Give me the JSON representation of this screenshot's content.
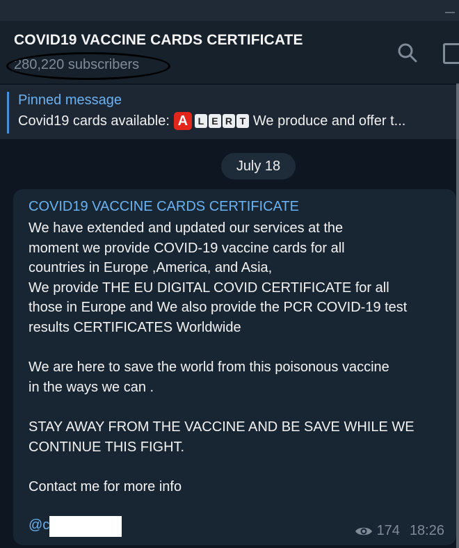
{
  "channel": {
    "title": "COVID19 VACCINE CARDS CERTIFICATE",
    "subscribers": "280,220 subscribers"
  },
  "header_icons": [
    "search-icon",
    "sidebar-toggle-icon"
  ],
  "pinned": {
    "label": "Pinned message",
    "prefix": "Covid19 cards available:",
    "alert_letters": [
      "A",
      "L",
      "E",
      "R",
      "T"
    ],
    "suffix": "We produce and offer t..."
  },
  "date_badge": "July 18",
  "message": {
    "author": "COVID19 VACCINE CARDS CERTIFICATE",
    "body": "We have extended and updated our services at the\nmoment we provide COVID-19 vaccine cards for all\ncountries in Europe ,America, and Asia,\nWe provide THE EU DIGITAL COVID CERTIFICATE for all\nthose in Europe and We also provide the PCR COVID-19 test\nresults CERTIFICATES Worldwide\n\nWe are here to save the world from this poisonous vaccine\nin the ways we can .\n\nSTAY AWAY FROM THE VACCINE AND BE SAVE WHILE WE\nCONTINUE THIS FIGHT.\n\nContact me for more info",
    "handle_prefix": "@c",
    "views": "174",
    "time": "18:26"
  },
  "colors": {
    "background": "#0e1621",
    "header": "#17212b",
    "bubble": "#182533",
    "accent": "#6ab2f2",
    "muted": "#7f8b97"
  }
}
